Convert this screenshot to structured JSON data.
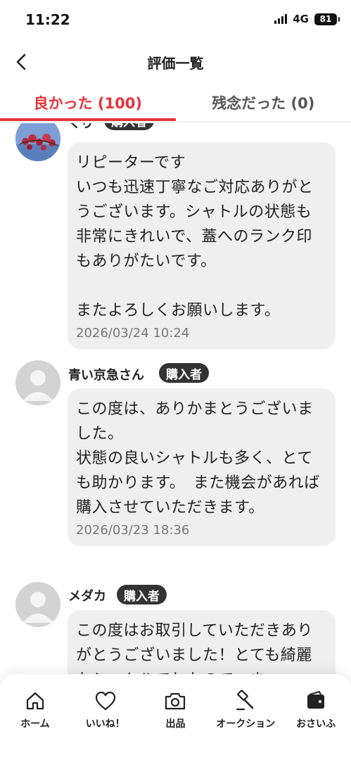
{
  "status": {
    "time": "11:22",
    "network": "4G",
    "battery": "81"
  },
  "header": {
    "title": "評価一覧"
  },
  "tabs": [
    {
      "label": "良かった (100)",
      "active": true
    },
    {
      "label": "残念だった (0)",
      "active": false
    }
  ],
  "reviews": [
    {
      "name": "ぐり",
      "badge": "購入者",
      "text": "リピーターです\nいつも迅速丁寧なご対応ありがとうございます。シャトルの状態も非常にきれいで、蓋へのランク印もありがたいです。\n\nまたよろしくお願いします。",
      "date": "2026/03/24 10:24"
    },
    {
      "name": "青い京急さん",
      "badge": "購入者",
      "text": "この度は、ありかまとうございました。\n状態の良いシャトルも多く、とても助かります。　また機会があれば購入させていただきます。",
      "date": "2026/03/23 18:36"
    },
    {
      "name": "メダカ",
      "badge": "購入者",
      "text": "この度はお取引していただきありがとうございました！とても綺麗なシャトルでしたので、ま",
      "date": ""
    }
  ],
  "bottom_nav": [
    {
      "label": "ホーム",
      "icon": "home-icon"
    },
    {
      "label": "いいね！",
      "icon": "heart-icon"
    },
    {
      "label": "出品",
      "icon": "camera-icon"
    },
    {
      "label": "オークション",
      "icon": "gavel-icon"
    },
    {
      "label": "おさいふ",
      "icon": "wallet-icon"
    }
  ],
  "colors": {
    "accent": "#e8323a",
    "bubble": "#efefef",
    "badge": "#333333"
  }
}
